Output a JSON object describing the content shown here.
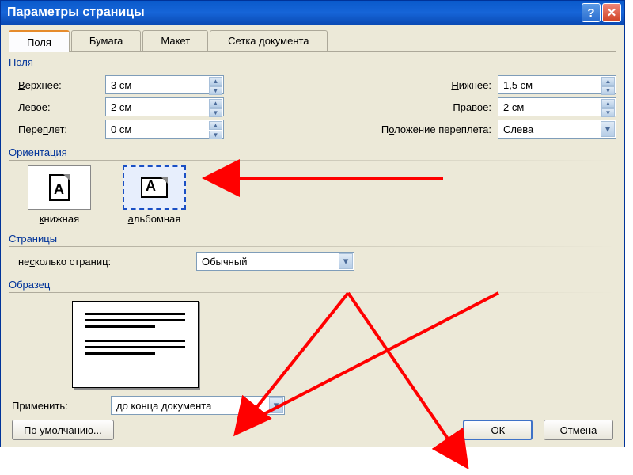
{
  "titlebar": {
    "title": "Параметры страницы"
  },
  "tabs": {
    "fields": "Поля",
    "paper": "Бумага",
    "layout": "Макет",
    "grid": "Сетка документа"
  },
  "fields_group": {
    "label": "Поля",
    "top_label": "Верхнее:",
    "top_value": "3 см",
    "bottom_label": "Нижнее:",
    "bottom_value": "1,5 см",
    "left_label": "Левое:",
    "left_value": "2 см",
    "right_label": "Правое:",
    "right_value": "2 см",
    "gutter_label": "Переплет:",
    "gutter_value": "0 см",
    "gutter_pos_label": "Положение переплета:",
    "gutter_pos_value": "Слева"
  },
  "orientation": {
    "label": "Ориентация",
    "portrait": "книжная",
    "landscape": "альбомная"
  },
  "pages": {
    "label": "Страницы",
    "multi_label": "несколько страниц:",
    "multi_value": "Обычный"
  },
  "preview": {
    "label": "Образец"
  },
  "apply": {
    "label": "Применить:",
    "value": "до конца документа"
  },
  "buttons": {
    "default": "По умолчанию...",
    "ok": "ОК",
    "cancel": "Отмена"
  }
}
